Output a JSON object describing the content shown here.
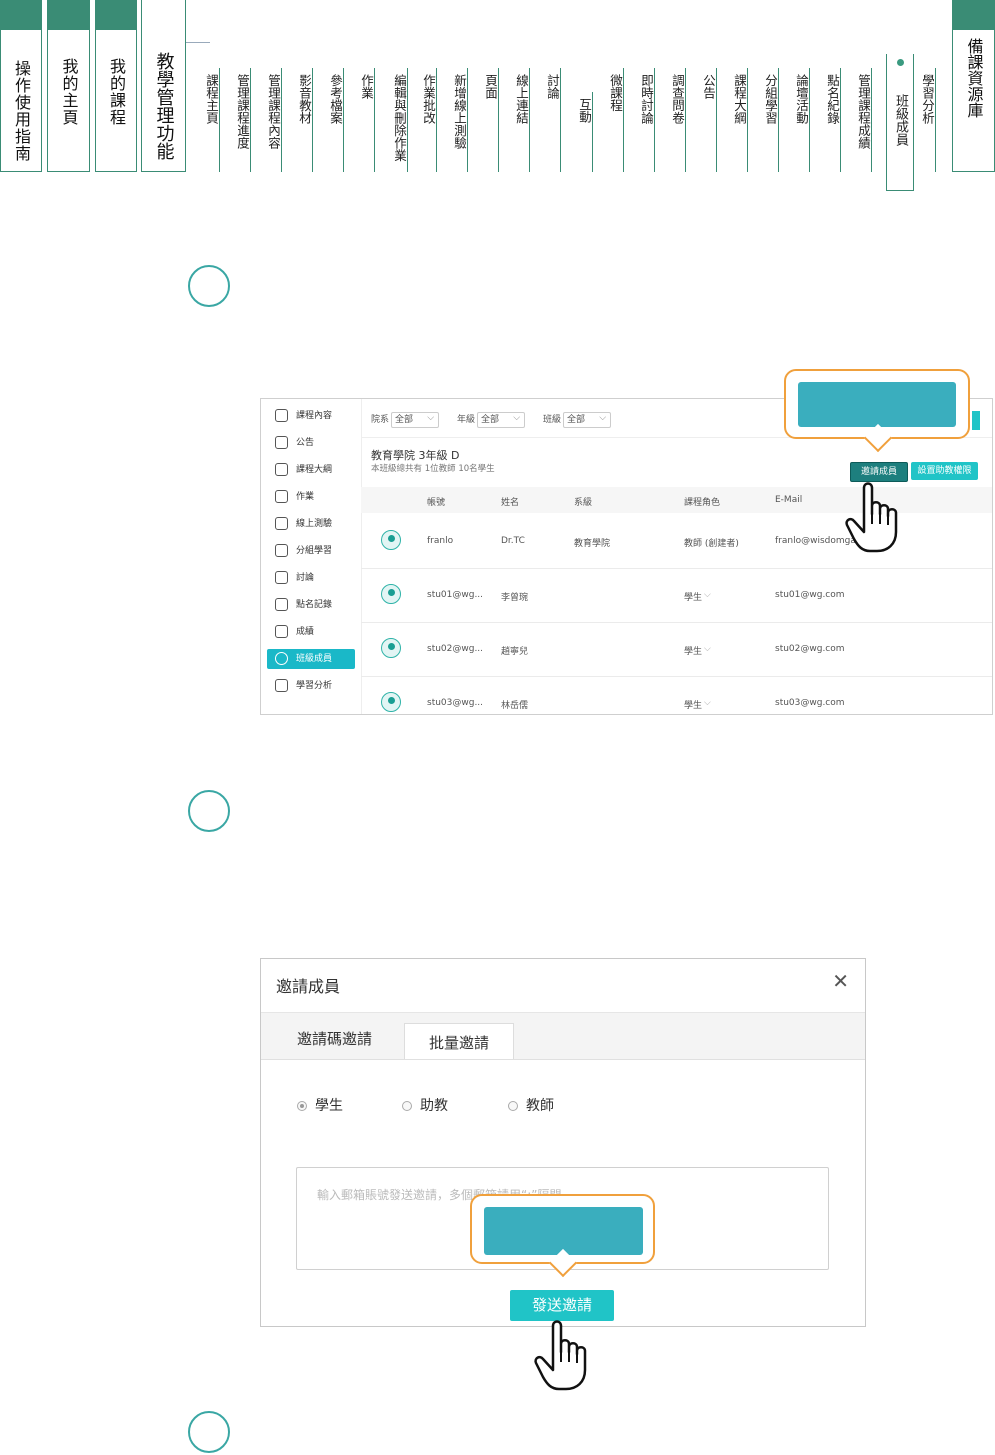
{
  "main_tabs": [
    {
      "label": "操作使用指南"
    },
    {
      "label": "我的主頁"
    },
    {
      "label": "我的課程"
    }
  ],
  "teaching_tab": {
    "label": "教學管理功能"
  },
  "sub_tabs": [
    "課程主頁",
    "管理課程進度",
    "管理課程內容",
    "影音教材",
    "參考檔案",
    "作業",
    "編輯與刪除作業",
    "作業批改",
    "新增線上測驗",
    "頁面",
    "線上連結",
    "討論",
    "互動",
    "微課程",
    "即時討論",
    "調查問卷",
    "公告",
    "課程大綱",
    "分組學習",
    "論壇活動",
    "點名紀錄",
    "管理課程成績",
    "班級成員",
    "學習分析"
  ],
  "resource_tab": {
    "label": "備課資源庫"
  },
  "shot1": {
    "sidebar": [
      "課程內容",
      "公告",
      "課程大綱",
      "作業",
      "線上測驗",
      "分組學習",
      "討論",
      "點名記錄",
      "成績",
      "班級成員",
      "學習分析"
    ],
    "filters": [
      {
        "label": "院系",
        "value": "全部"
      },
      {
        "label": "年級",
        "value": "全部"
      },
      {
        "label": "班級",
        "value": "全部"
      }
    ],
    "class_title": "教育學院 3年級 D",
    "class_sub": "本班級總共有 1位教師 10名學生",
    "invite_button": "邀請成員",
    "ta_button": "設置助教權限",
    "columns": [
      "帳號",
      "姓名",
      "系級",
      "課程角色",
      "E-Mail"
    ],
    "rows": [
      {
        "account": "franlo",
        "name": "Dr.TC",
        "dept": "教育學院",
        "role": "教師 (創建者)",
        "email": "franlo@wisdomgarden"
      },
      {
        "account": "stu01@wg...",
        "name": "李曾琬",
        "dept": "",
        "role": "學生",
        "email": "stu01@wg.com"
      },
      {
        "account": "stu02@wg...",
        "name": "趙寧兒",
        "dept": "",
        "role": "學生",
        "email": "stu02@wg.com"
      },
      {
        "account": "stu03@wg...",
        "name": "林岳儒",
        "dept": "",
        "role": "學生",
        "email": "stu03@wg.com"
      }
    ]
  },
  "dialog": {
    "title": "邀請成員",
    "tabs": [
      "邀請碼邀請",
      "批量邀請"
    ],
    "roles": [
      "學生",
      "助教",
      "教師"
    ],
    "placeholder": "輸入郵箱賬號發送邀請，多個郵箱請用“;”隔開",
    "send_button": "發送邀請"
  },
  "colors": {
    "accent": "#3a8c75",
    "teal": "#20c4c7",
    "callout": "#f0a03c"
  }
}
